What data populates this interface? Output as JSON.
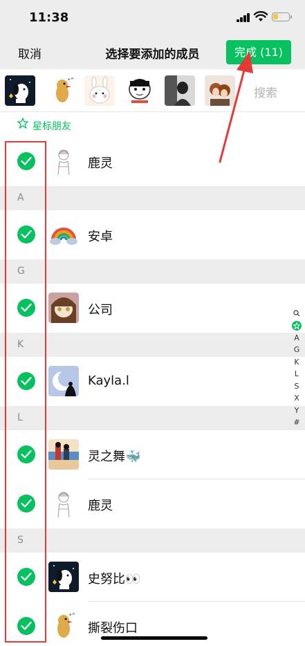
{
  "status_bar": {
    "time": "11:38",
    "battery_level": 0.2
  },
  "nav": {
    "cancel_label": "取消",
    "title": "选择要添加的成员",
    "done_label": "完成 (11)"
  },
  "selected_strip": {
    "avatars": [
      "snoopy-avatar",
      "duck-sticker-avatar",
      "bunny-sticker-avatar",
      "meme-face-avatar",
      "photo-avatar",
      "anime-couple-avatar"
    ],
    "search_label": "搜索"
  },
  "starred": {
    "label": "星标朋友"
  },
  "sections": [
    {
      "letter": "",
      "rows": [
        {
          "name": "鹿灵",
          "avatar": "sketch-girl-avatar",
          "selected": true
        }
      ]
    },
    {
      "letter": "A",
      "rows": [
        {
          "name": "安卓",
          "avatar": "rainbow-avatar",
          "selected": true
        }
      ]
    },
    {
      "letter": "G",
      "rows": [
        {
          "name": "公司",
          "avatar": "anime-girl-avatar",
          "selected": true
        }
      ]
    },
    {
      "letter": "K",
      "rows": [
        {
          "name": "Kayla.l",
          "avatar": "moon-avatar",
          "selected": true
        }
      ]
    },
    {
      "letter": "L",
      "rows": [
        {
          "name": "灵之舞🐳",
          "avatar": "beach-avatar",
          "selected": true
        },
        {
          "name": "鹿灵",
          "avatar": "sketch-girl-avatar",
          "selected": true
        }
      ]
    },
    {
      "letter": "S",
      "rows": [
        {
          "name": "史努比👀",
          "avatar": "snoopy-avatar",
          "selected": true
        },
        {
          "name": "撕裂伤口",
          "avatar": "duck-sticker-avatar",
          "selected": true
        }
      ]
    }
  ],
  "index_bar": [
    "A",
    "G",
    "K",
    "L",
    "S",
    "X",
    "Y",
    "#"
  ],
  "colors": {
    "accent": "#07c160",
    "annotation": "#e53935",
    "background": "#ededed"
  }
}
